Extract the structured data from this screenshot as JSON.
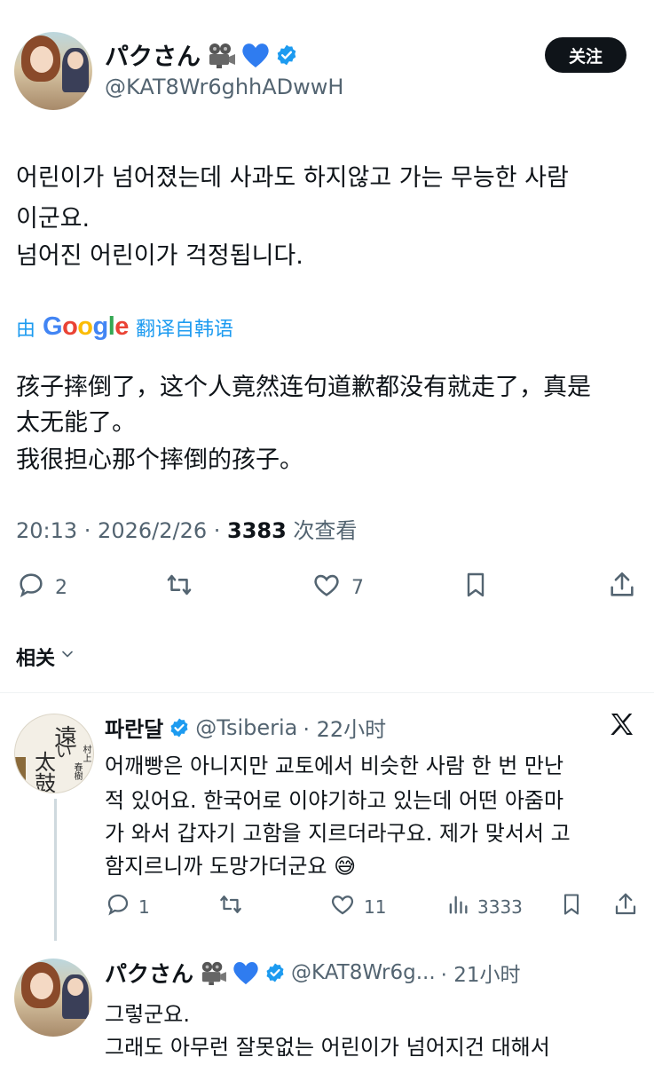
{
  "main_post": {
    "name": "パクさん",
    "handle": "@KAT8Wr6ghhADwwH",
    "follow_label": "关注",
    "text_lines": [
      "어린이가 넘어졌는데 사과도 하지않고 가는 무능한 사람",
      "이군요.",
      "넘어진 어린이가 걱정됩니다."
    ],
    "translate_prefix": "由",
    "translate_brand": "Google",
    "translate_suffix": "翻译自韩语",
    "translated_lines": [
      "孩子摔倒了，这个人竟然连句道歉都没有就走了，真是",
      "太无能了。",
      "我很担心那个摔倒的孩子。"
    ],
    "time": "20:13 · 2026/2/26 · ",
    "views": "3383",
    "views_label": " 次查看",
    "reply_count": "2",
    "like_count": "7"
  },
  "related_label": "相关",
  "reply_1": {
    "name": "파란달",
    "handle": "@Tsiberia",
    "time": "· 22小时",
    "avatar_chars": [
      "遠",
      "い",
      "太",
      "鼓",
      "村上",
      "春樹"
    ],
    "text_lines": [
      "어깨빵은 아니지만 교토에서 비슷한 사람 한 번 만난",
      "적 있어요.  한국어로 이야기하고 있는데 어떤 아줌마",
      "가 와서 갑자기 고함을 지르더라구요. 제가 맞서서 고",
      "함지르니까 도망가더군요 😅"
    ],
    "reply_count": "1",
    "like_count": "11",
    "view_count": "3333"
  },
  "reply_2": {
    "name": "パクさん",
    "handle": "@KAT8Wr6g...",
    "time": "· 21小时",
    "text_lines": [
      "그렇군요.",
      "그래도 아무런 잘못없는 어린이가 넘어지건 대해서"
    ]
  },
  "colors": {
    "text": "#0f1419",
    "secondary": "#536471",
    "link": "#1d9bf0",
    "verified": "#1d9bf0",
    "heart_emoji": "#1d9bf0"
  },
  "icons": [
    "projector-emoji-icon",
    "blue-heart-icon",
    "verified-badge-icon",
    "reply-icon",
    "retweet-icon",
    "like-icon",
    "bookmark-icon",
    "share-icon",
    "views-icon",
    "x-logo-icon",
    "chevron-down-icon"
  ]
}
